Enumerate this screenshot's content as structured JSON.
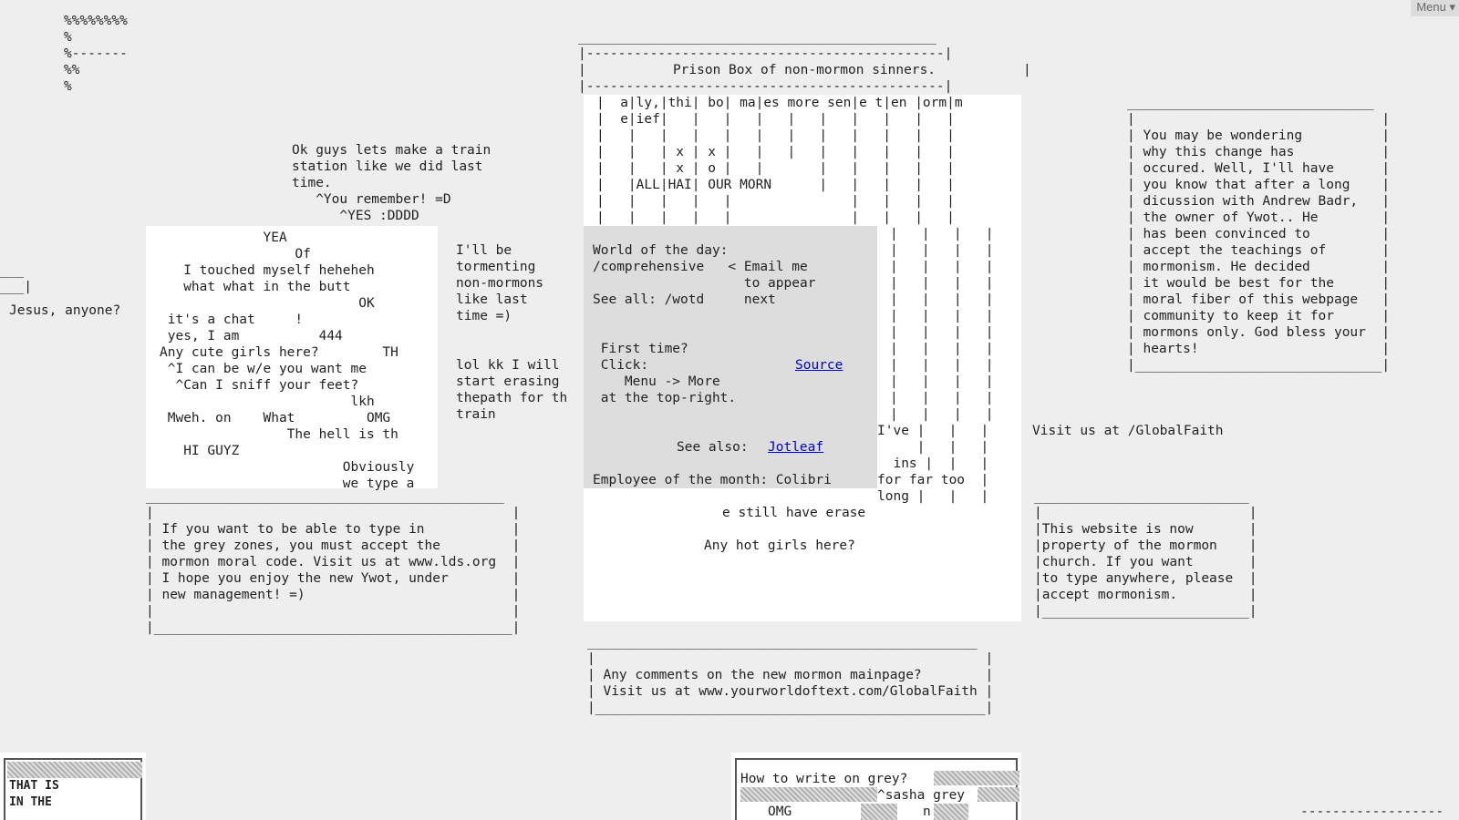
{
  "menu": {
    "label": "Menu ▾"
  },
  "top_left_art": "%%%%%%%%\n%\n%-------\n%%\n%",
  "left_edge_art": "___\n___|",
  "left_chat": "Jesus, anyone?",
  "train_text": "Ok guys lets make a train\nstation like we did last\ntime.\n   ^You remember! =D\n      ^YES :DDDD",
  "graffiti": {
    "lines": "             YEA\n                 Of\n   I touched myself heheheh\n   what what in the butt\n                         OK\n it's a chat     !\n yes, I am          444\nAny cute girls here?        TH\n ^I can be w/e you want me\n  ^Can I sniff your feet?\n                        lkh\n Mweh. on    What         OMG\n                The hell is th\n   HI GUYZ\n                       Obviously\n                       we type a"
  },
  "middle_chat": "I'll be\ntormenting\nnon-mormons\nlike last\ntime =)\n\n\nlol kk I will\nstart erasing\nthepath for th\ntrain",
  "prison_box": {
    "title": "Prison Box of non-mormon sinners.",
    "top_rule": "_____________________________________________\n|---------------------------------------------|\n|",
    "bottom_rule": "|---------------------------------------------|"
  },
  "prison_columns_text": "|  a|ly,|thi| bo| ma|es more sen|e t|en |orm|m\n|  e|ief|   |   |   |   |   |   |   |   |   |\n|   |   |   |   |   |   |   |   |   |   |   |\n|   |   | x | x |   |   |   |   |   |   |   |\n|   |   | x | o |   |       |   |   |   |   |\n|   |ALL|HAI| OUR MORN      |   |   |   |   |\n|   |   |   |   |               |   |   |   |\n|   |   |   |   |               |   |   |   |",
  "prison_right_bars": "|   |   |   |\n|   |   |   |\n|   |   |   |\n|   |   |   |\n|   |   |   |\n|   |   |   |\n|   |   |   |\n|   |   |   |\n|   |   |   |\n|   |   |   |\n|   |   |   |\n|   |   |   |",
  "prison_lower_text": "I've |   |   |\n     |   |   |\n  ins |  |   |\nfor far too  |\nlong |   |   |",
  "wotd": {
    "line1": "World of the day:",
    "line2": "/comprehensive   < Email me",
    "line3": "                   to appear",
    "line4": "See all: /wotd     next",
    "first_time": " First time?",
    "click": " Click:",
    "source_link": "Source",
    "menu_more": "    Menu -> More",
    "top_right": " at the top-right.",
    "see_also": "See also: ",
    "jotleaf_link": "Jotleaf",
    "employee": "Employee of the month: Colibri"
  },
  "still_erase": "e still have erase",
  "hot_girls": "Any hot girls here?",
  "explain_box": "_______________________________\n|                               |\n| You may be wondering          |\n| why this change has           |\n| occured. Well, I'll have      |\n| you know that after a long    |\n| dicussion with Andrew Badr,   |\n| the owner of Ywot.. He        |\n| has been convinced to         |\n| accept the teachings of       |\n| mormonism. He decided         |\n| it would be best for the      |\n| moral fiber of this webpage   |\n| community to keep it for      |\n| mormons only. God bless your  |\n| hearts!                       |\n|_______________________________|",
  "visit_globalfaith": "Visit us at /GlobalFaith",
  "grey_zones_box": "_____________________________________________\n|                                             |\n| If you want to be able to type in           |\n| the grey zones, you must accept the         |\n| mormon moral code. Visit us at www.lds.org  |\n| I hope you enjoy the new Ywot, under        |\n| new management! =)                          |\n|                                             |\n|_____________________________________________|",
  "property_box": "___________________________\n|                          |\n|This website is now       |\n|property of the mormon    |\n|church. If you want       |\n|to type anywhere, please  |\n|accept mormonism.         |\n|__________________________|",
  "comments_box": "_________________________________________________\n|                                                 |\n| Any comments on the new mormon mainpage?        |\n| Visit us at www.yourworldoftext.com/GlobalFaith |\n|_________________________________________________|",
  "bottom_left": {
    "line1": "THAT IS",
    "line2": "IN THE"
  },
  "bottom_grey": {
    "question": "How to write on grey?",
    "reply": "^sasha grey",
    "omg": "OMG",
    "n": "n"
  },
  "bottom_right_rule": "------------------"
}
